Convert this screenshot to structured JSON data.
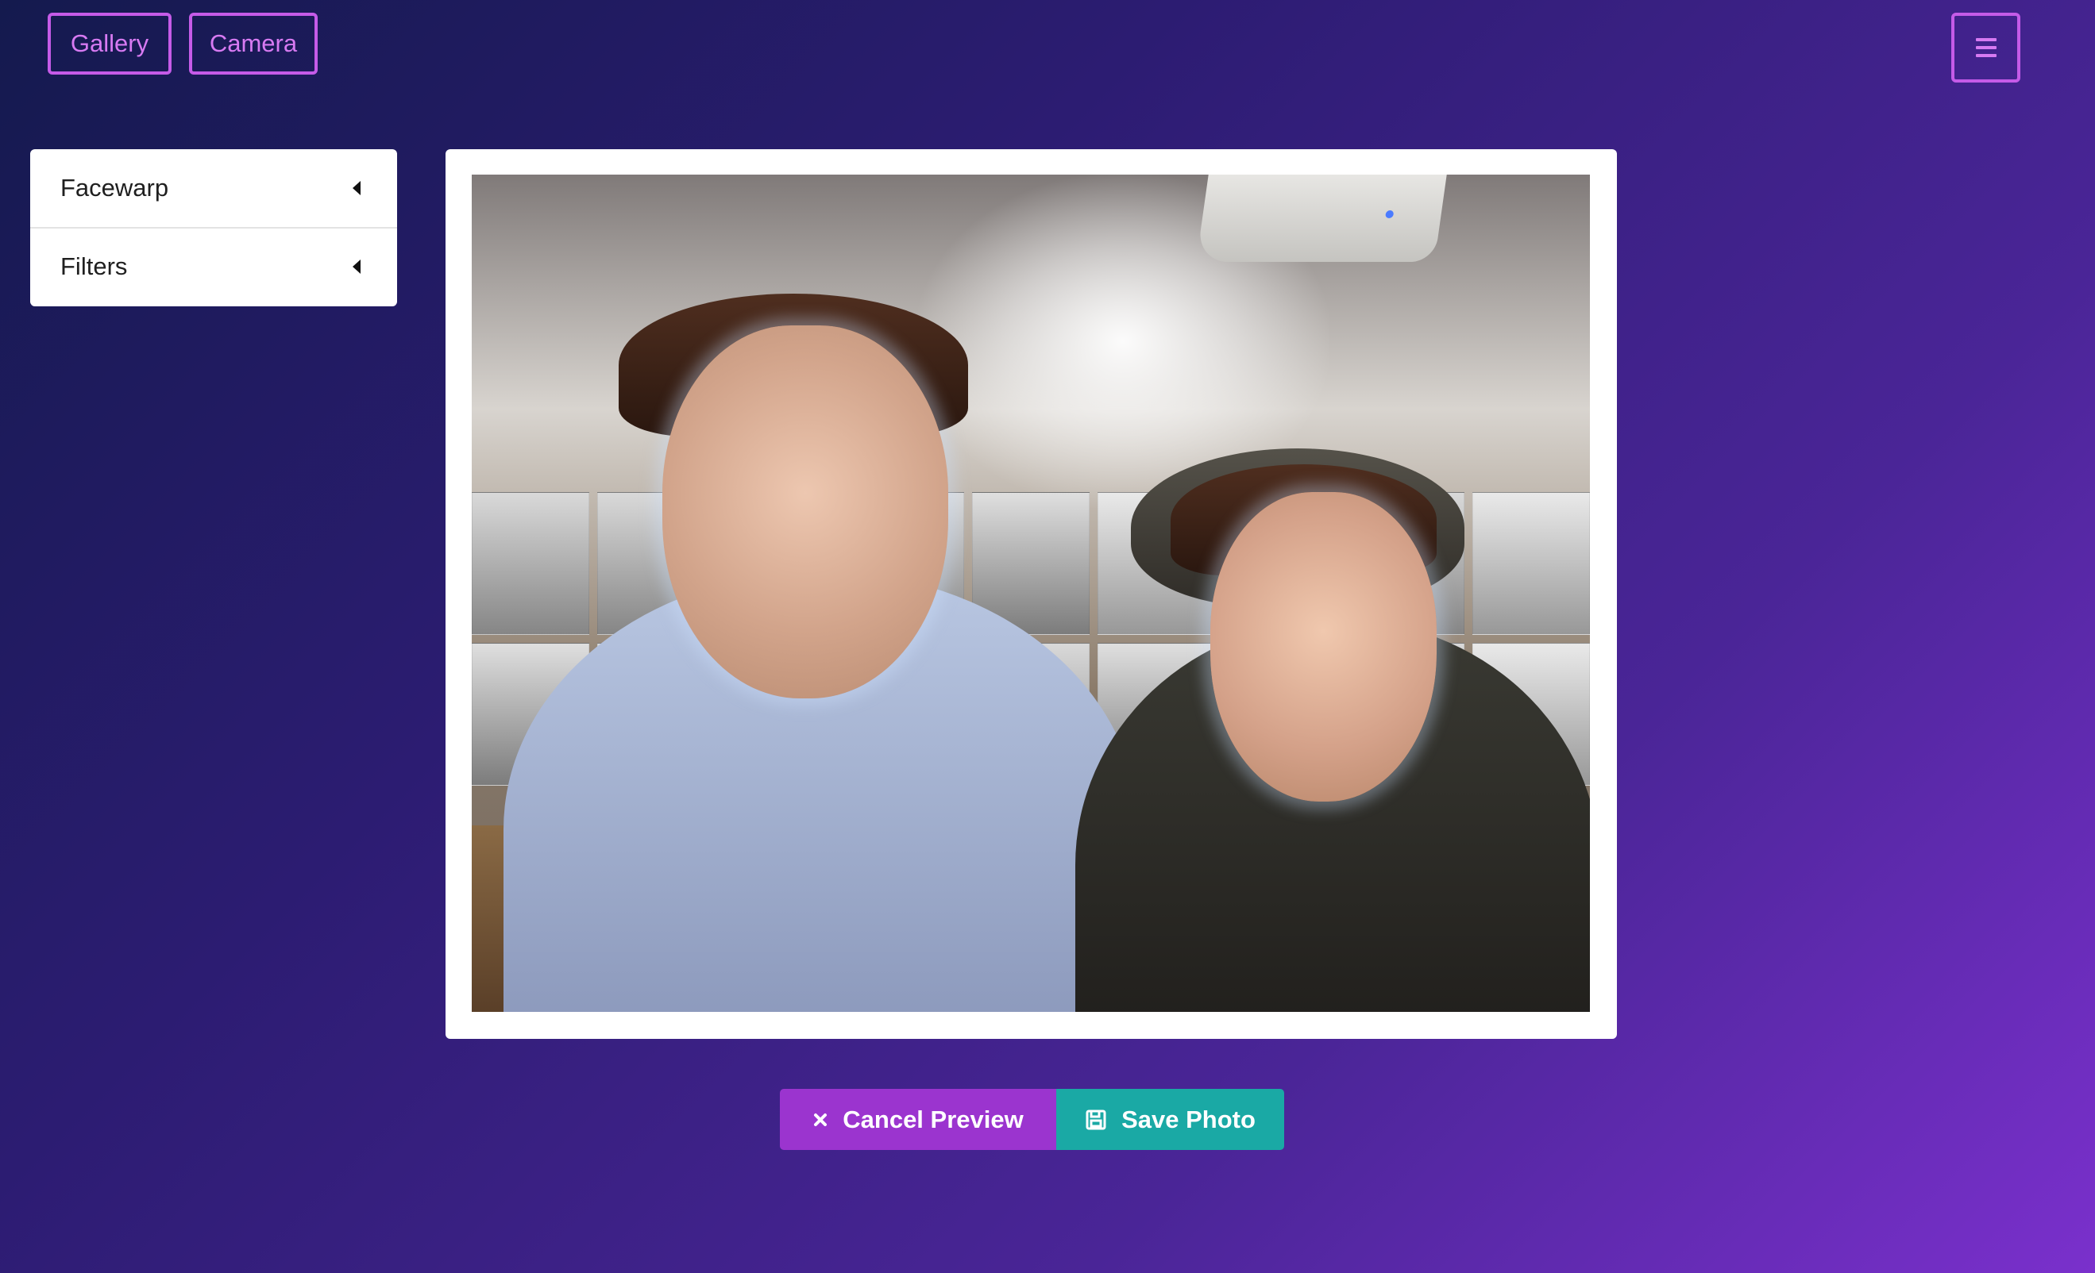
{
  "nav": {
    "gallery_label": "Gallery",
    "camera_label": "Camera",
    "menu_icon": "hamburger-icon"
  },
  "sidebar": {
    "items": [
      {
        "label": "Facewarp",
        "icon": "caret-left-icon"
      },
      {
        "label": "Filters",
        "icon": "caret-left-icon"
      }
    ]
  },
  "preview": {
    "image_semantic": "face-swapped preview photo"
  },
  "actions": {
    "cancel_label": "Cancel Preview",
    "save_label": "Save Photo",
    "cancel_icon": "close-icon",
    "save_icon": "save-icon"
  },
  "colors": {
    "accent_purple": "#c55be8",
    "cancel_bg": "#9b34cf",
    "save_bg": "#1aa9a5"
  }
}
